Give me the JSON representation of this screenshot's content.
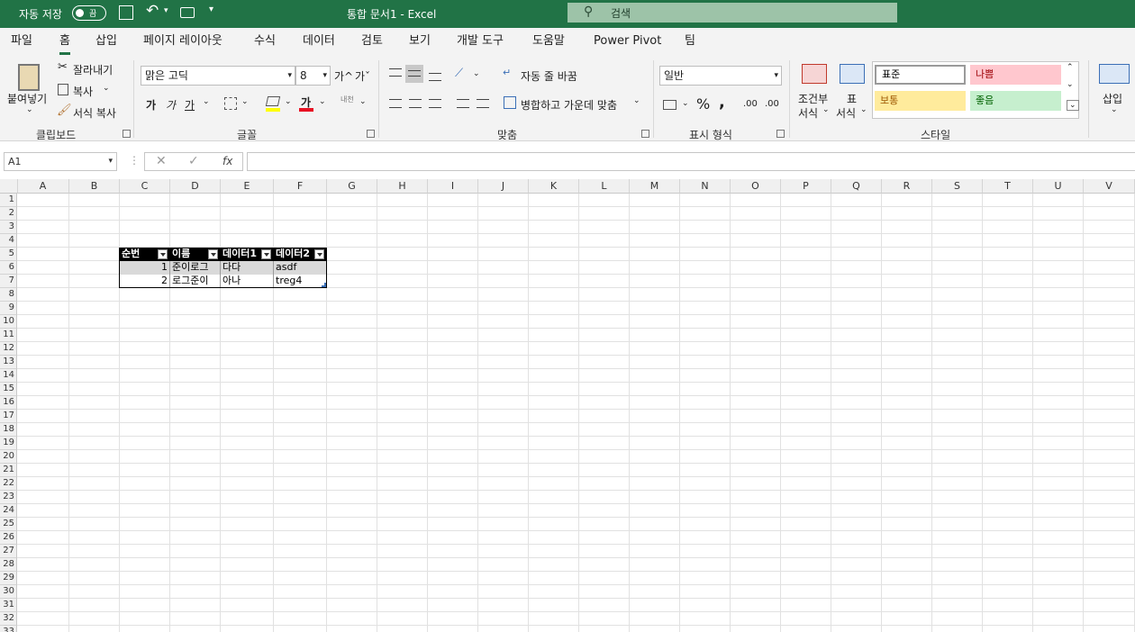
{
  "titlebar": {
    "autosave_label": "자동 저장",
    "autosave_state": "끔",
    "doc_title": "통합 문서1  -  Excel",
    "search_placeholder": "검색",
    "accent": "#217346"
  },
  "tabs": [
    "파일",
    "홈",
    "삽입",
    "페이지 레이아웃",
    "수식",
    "데이터",
    "검토",
    "보기",
    "개발 도구",
    "도움말",
    "Power Pivot",
    "팀"
  ],
  "ribbon": {
    "clipboard": {
      "paste": "붙여넣기",
      "cut": "잘라내기",
      "copy": "복사",
      "format_painter": "서식 복사",
      "group": "클립보드"
    },
    "font": {
      "name": "맑은 고딕",
      "size": "8",
      "grow": "가^",
      "shrink": "가ˇ",
      "bold": "가",
      "italic": "가",
      "underline": "가",
      "phonetic": "내천",
      "group": "글꼴"
    },
    "alignment": {
      "wrap": "자동 줄 바꿈",
      "merge": "병합하고 가운데 맞춤",
      "group": "맞춤"
    },
    "number": {
      "format": "일반",
      "percent": "%",
      "comma": ",",
      "inc_decimal": ".00",
      "dec_decimal": ".00",
      "group": "표시 형식"
    },
    "styles": {
      "conditional_1": "조건부",
      "conditional_2": "서식",
      "table_1": "표",
      "table_2": "서식",
      "normal": "표준",
      "bad": "나쁨",
      "neutral": "보통",
      "good": "좋음",
      "group": "스타일"
    },
    "cells": {
      "insert": "삽입"
    }
  },
  "formula": {
    "namebox": "A1",
    "fx": "fx",
    "content": ""
  },
  "columns": [
    "A",
    "B",
    "C",
    "D",
    "E",
    "F",
    "G",
    "H",
    "I",
    "J",
    "K",
    "L",
    "M",
    "N",
    "O",
    "P",
    "Q",
    "R",
    "S",
    "T",
    "U",
    "V"
  ],
  "rows": [
    "1",
    "2",
    "3",
    "4",
    "5",
    "6",
    "7",
    "8",
    "9",
    "10",
    "11",
    "12",
    "13",
    "14",
    "15",
    "16",
    "17",
    "18",
    "19",
    "20",
    "21",
    "22",
    "23",
    "24",
    "25",
    "26",
    "27",
    "28",
    "29",
    "30",
    "31",
    "32",
    "33"
  ],
  "table": {
    "headers": [
      "순번",
      "이름",
      "데이터1",
      "데이터2"
    ],
    "rows": [
      [
        "1",
        "준이로그",
        "다다",
        "asdf"
      ],
      [
        "2",
        "로그준이",
        "아나",
        "treg4"
      ]
    ]
  }
}
